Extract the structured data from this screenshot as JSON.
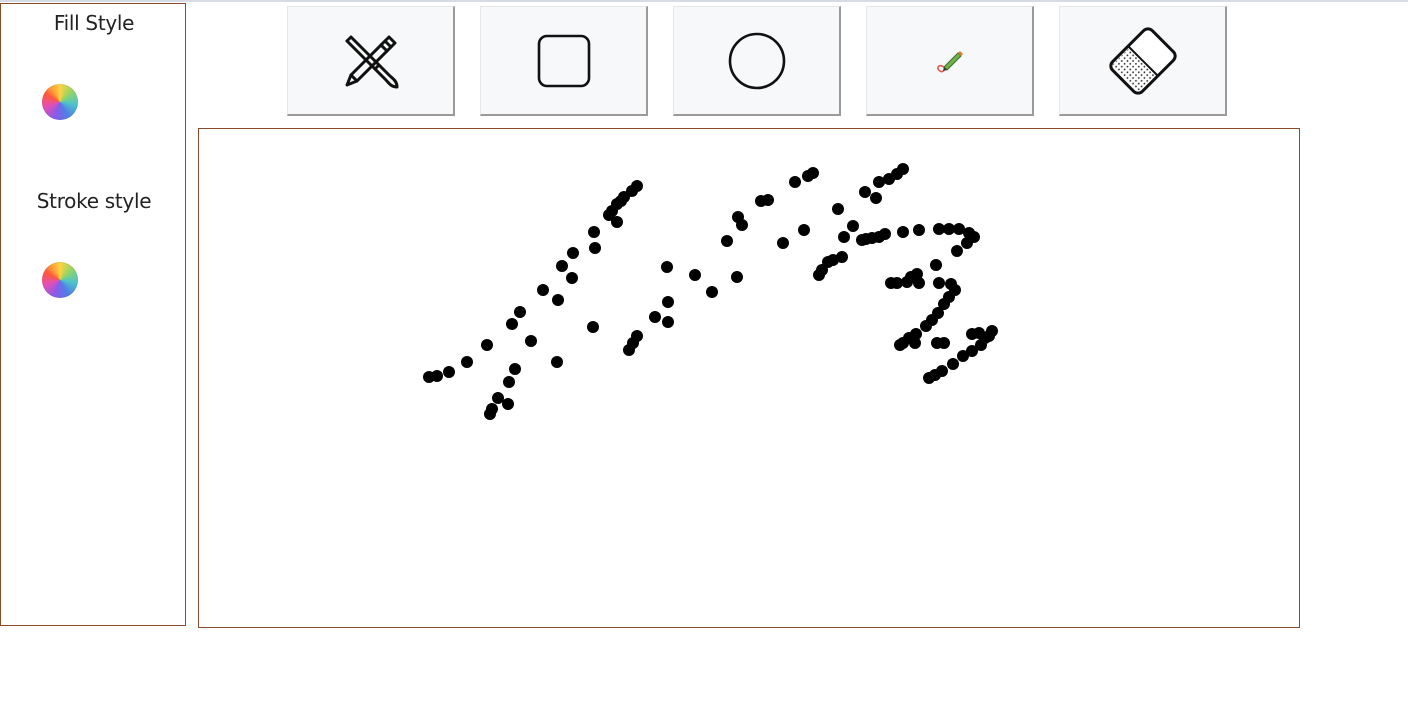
{
  "sidebar": {
    "fill_label": "Fill Style",
    "stroke_label": "Stroke style",
    "fill_picker_icon": "color-wheel-icon",
    "stroke_picker_icon": "color-wheel-icon"
  },
  "toolbar": {
    "tools": [
      {
        "name": "pencil-brush-tool",
        "icon": "pencil-brush-icon"
      },
      {
        "name": "rectangle-tool",
        "icon": "rounded-square-icon"
      },
      {
        "name": "circle-tool",
        "icon": "circle-icon"
      },
      {
        "name": "color-pen-tool",
        "icon": "colored-pencil-icon"
      },
      {
        "name": "eraser-tool",
        "icon": "eraser-icon"
      }
    ]
  },
  "colors": {
    "border": "#8b4a2b",
    "tool_bg": "#f7f8f9",
    "ink": "#000000"
  }
}
